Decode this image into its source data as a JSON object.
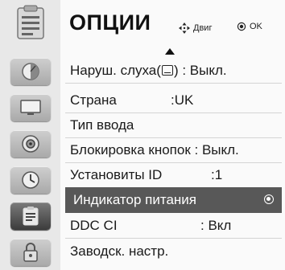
{
  "header": {
    "title": "ОПЦИИ",
    "nav_hint_label": "Двиг",
    "ok_hint_label": "OK"
  },
  "sidebar": {
    "header_icon": "options-icon",
    "items": [
      {
        "icon": "picture-icon",
        "active": false
      },
      {
        "icon": "tv-icon",
        "active": false
      },
      {
        "icon": "speaker-icon",
        "active": false
      },
      {
        "icon": "clock-icon",
        "active": false
      },
      {
        "icon": "options-icon",
        "active": true
      },
      {
        "icon": "lock-icon",
        "active": false
      }
    ]
  },
  "menu": {
    "items": [
      {
        "label": "Наруш. слуха(",
        "suffix": ") : Выкл."
      },
      {
        "label": "Страна",
        "value": ":UK"
      },
      {
        "label": "Тип ввода",
        "value": ""
      },
      {
        "label": "Блокировка кнопок : Выкл.",
        "value": ""
      },
      {
        "label": "Установиты ID",
        "value": ":1"
      },
      {
        "label": "Индикатор питания",
        "value": "",
        "selected": true
      },
      {
        "label": "DDC CI",
        "value": ": Вкл"
      },
      {
        "label": "Заводск. настр.",
        "value": ""
      }
    ]
  }
}
